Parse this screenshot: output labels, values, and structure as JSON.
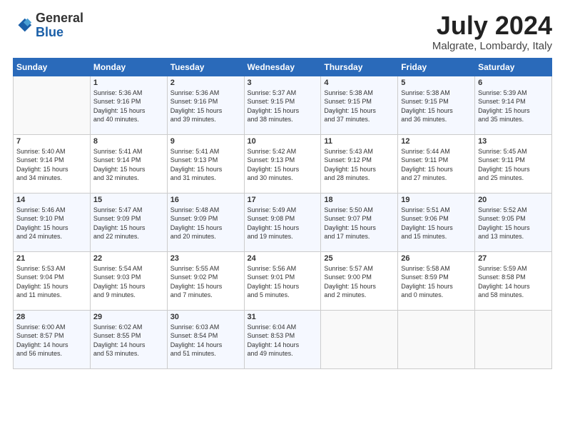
{
  "header": {
    "logo_line1": "General",
    "logo_line2": "Blue",
    "month_year": "July 2024",
    "location": "Malgrate, Lombardy, Italy"
  },
  "columns": [
    "Sunday",
    "Monday",
    "Tuesday",
    "Wednesday",
    "Thursday",
    "Friday",
    "Saturday"
  ],
  "weeks": [
    [
      {
        "day": "",
        "info": ""
      },
      {
        "day": "1",
        "info": "Sunrise: 5:36 AM\nSunset: 9:16 PM\nDaylight: 15 hours\nand 40 minutes."
      },
      {
        "day": "2",
        "info": "Sunrise: 5:36 AM\nSunset: 9:16 PM\nDaylight: 15 hours\nand 39 minutes."
      },
      {
        "day": "3",
        "info": "Sunrise: 5:37 AM\nSunset: 9:15 PM\nDaylight: 15 hours\nand 38 minutes."
      },
      {
        "day": "4",
        "info": "Sunrise: 5:38 AM\nSunset: 9:15 PM\nDaylight: 15 hours\nand 37 minutes."
      },
      {
        "day": "5",
        "info": "Sunrise: 5:38 AM\nSunset: 9:15 PM\nDaylight: 15 hours\nand 36 minutes."
      },
      {
        "day": "6",
        "info": "Sunrise: 5:39 AM\nSunset: 9:14 PM\nDaylight: 15 hours\nand 35 minutes."
      }
    ],
    [
      {
        "day": "7",
        "info": "Sunrise: 5:40 AM\nSunset: 9:14 PM\nDaylight: 15 hours\nand 34 minutes."
      },
      {
        "day": "8",
        "info": "Sunrise: 5:41 AM\nSunset: 9:14 PM\nDaylight: 15 hours\nand 32 minutes."
      },
      {
        "day": "9",
        "info": "Sunrise: 5:41 AM\nSunset: 9:13 PM\nDaylight: 15 hours\nand 31 minutes."
      },
      {
        "day": "10",
        "info": "Sunrise: 5:42 AM\nSunset: 9:13 PM\nDaylight: 15 hours\nand 30 minutes."
      },
      {
        "day": "11",
        "info": "Sunrise: 5:43 AM\nSunset: 9:12 PM\nDaylight: 15 hours\nand 28 minutes."
      },
      {
        "day": "12",
        "info": "Sunrise: 5:44 AM\nSunset: 9:11 PM\nDaylight: 15 hours\nand 27 minutes."
      },
      {
        "day": "13",
        "info": "Sunrise: 5:45 AM\nSunset: 9:11 PM\nDaylight: 15 hours\nand 25 minutes."
      }
    ],
    [
      {
        "day": "14",
        "info": "Sunrise: 5:46 AM\nSunset: 9:10 PM\nDaylight: 15 hours\nand 24 minutes."
      },
      {
        "day": "15",
        "info": "Sunrise: 5:47 AM\nSunset: 9:09 PM\nDaylight: 15 hours\nand 22 minutes."
      },
      {
        "day": "16",
        "info": "Sunrise: 5:48 AM\nSunset: 9:09 PM\nDaylight: 15 hours\nand 20 minutes."
      },
      {
        "day": "17",
        "info": "Sunrise: 5:49 AM\nSunset: 9:08 PM\nDaylight: 15 hours\nand 19 minutes."
      },
      {
        "day": "18",
        "info": "Sunrise: 5:50 AM\nSunset: 9:07 PM\nDaylight: 15 hours\nand 17 minutes."
      },
      {
        "day": "19",
        "info": "Sunrise: 5:51 AM\nSunset: 9:06 PM\nDaylight: 15 hours\nand 15 minutes."
      },
      {
        "day": "20",
        "info": "Sunrise: 5:52 AM\nSunset: 9:05 PM\nDaylight: 15 hours\nand 13 minutes."
      }
    ],
    [
      {
        "day": "21",
        "info": "Sunrise: 5:53 AM\nSunset: 9:04 PM\nDaylight: 15 hours\nand 11 minutes."
      },
      {
        "day": "22",
        "info": "Sunrise: 5:54 AM\nSunset: 9:03 PM\nDaylight: 15 hours\nand 9 minutes."
      },
      {
        "day": "23",
        "info": "Sunrise: 5:55 AM\nSunset: 9:02 PM\nDaylight: 15 hours\nand 7 minutes."
      },
      {
        "day": "24",
        "info": "Sunrise: 5:56 AM\nSunset: 9:01 PM\nDaylight: 15 hours\nand 5 minutes."
      },
      {
        "day": "25",
        "info": "Sunrise: 5:57 AM\nSunset: 9:00 PM\nDaylight: 15 hours\nand 2 minutes."
      },
      {
        "day": "26",
        "info": "Sunrise: 5:58 AM\nSunset: 8:59 PM\nDaylight: 15 hours\nand 0 minutes."
      },
      {
        "day": "27",
        "info": "Sunrise: 5:59 AM\nSunset: 8:58 PM\nDaylight: 14 hours\nand 58 minutes."
      }
    ],
    [
      {
        "day": "28",
        "info": "Sunrise: 6:00 AM\nSunset: 8:57 PM\nDaylight: 14 hours\nand 56 minutes."
      },
      {
        "day": "29",
        "info": "Sunrise: 6:02 AM\nSunset: 8:55 PM\nDaylight: 14 hours\nand 53 minutes."
      },
      {
        "day": "30",
        "info": "Sunrise: 6:03 AM\nSunset: 8:54 PM\nDaylight: 14 hours\nand 51 minutes."
      },
      {
        "day": "31",
        "info": "Sunrise: 6:04 AM\nSunset: 8:53 PM\nDaylight: 14 hours\nand 49 minutes."
      },
      {
        "day": "",
        "info": ""
      },
      {
        "day": "",
        "info": ""
      },
      {
        "day": "",
        "info": ""
      }
    ]
  ]
}
